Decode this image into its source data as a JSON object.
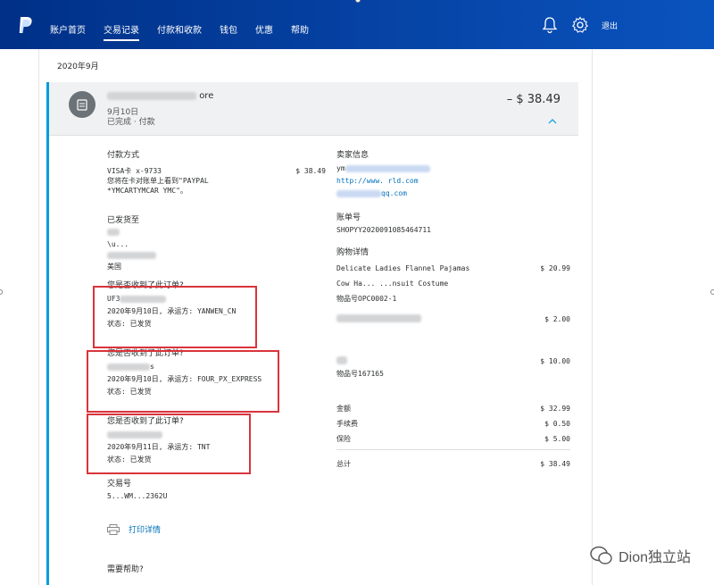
{
  "nav": {
    "items": [
      "账户首页",
      "交易记录",
      "付款和收款",
      "钱包",
      "优惠",
      "帮助"
    ],
    "logout": "退出"
  },
  "month": "2020年9月",
  "transaction": {
    "merchant_visible": "ore",
    "date": "9月10日",
    "status": "已完成 · 付款",
    "amount": "– $ 38.49"
  },
  "payment": {
    "label": "付款方式",
    "card": "VISA卡 x-9733",
    "card_amount": "$ 38.49",
    "statement_line1": "您将在卡对账单上看到\"PAYPAL",
    "statement_line2": "*YMCARTYMCAR YMC\"。"
  },
  "shipping": {
    "label": "已发货至",
    "line2": "\\u...",
    "country": "美国"
  },
  "orders": [
    {
      "question": "您是否收到了此订单?",
      "tracking": "UF3",
      "shipped": "2020年9月10日, 承运方: YANWEN_CN",
      "status": "状态: 已发货"
    },
    {
      "question": "您是否收到了此订单?",
      "tracking": "s",
      "shipped": "2020年9月10日, 承运方: FOUR_PX_EXPRESS",
      "status": "状态: 已发货"
    },
    {
      "question": "您是否收到了此订单?",
      "tracking": "",
      "shipped": "2020年9月11日, 承运方: TNT",
      "status": "状态: 已发货"
    }
  ],
  "txid": {
    "label": "交易号",
    "value": "5...WM...2362U"
  },
  "print_label": "打印详情",
  "help_label": "需要帮助?",
  "seller": {
    "label": "卖家信息",
    "line1": "ym",
    "url": "http://www.      rld.com",
    "email": "qq.com"
  },
  "invoice": {
    "label": "账单号",
    "value": "SHOPYY2020091085464711"
  },
  "purchase": {
    "label": "购物详情",
    "items": [
      {
        "name": "Delicate Ladies Flannel Pajamas",
        "price": "$ 20.99"
      },
      {
        "name": "Cow Ha...  ...nsuit Costume",
        "price": ""
      },
      {
        "name": "物品号OPC0002-1",
        "price": ""
      },
      {
        "name": "",
        "price": "$ 2.00"
      },
      {
        "name": "",
        "price": "$ 10.00"
      },
      {
        "name": "物品号167165",
        "price": ""
      }
    ]
  },
  "totals": [
    {
      "label": "金额",
      "value": "$ 32.99"
    },
    {
      "label": "手续费",
      "value": "$ 0.50"
    },
    {
      "label": "保险",
      "value": "$ 5.00"
    }
  ],
  "grand_total": {
    "label": "总计",
    "value": "$ 38.49"
  },
  "watermark": "Dion独立站",
  "colors": {
    "nav_bg": "#003087",
    "accent": "#009cde",
    "highlight_box": "#d9343c",
    "link": "#0070ba"
  }
}
